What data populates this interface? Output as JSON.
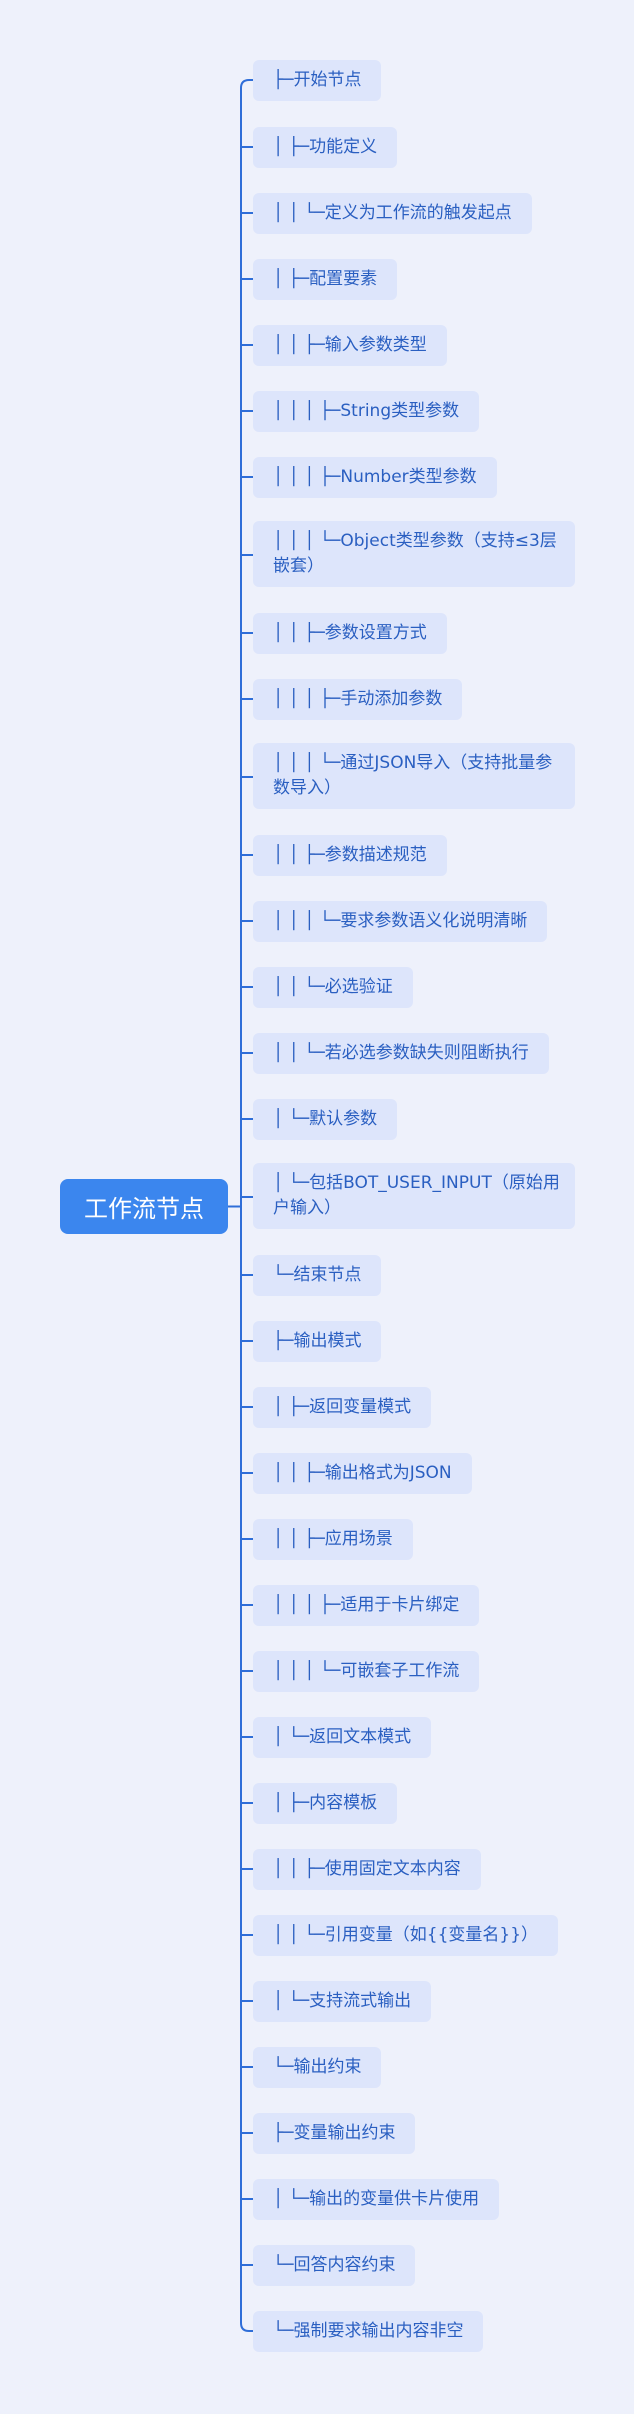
{
  "root": {
    "label": "工作流节点"
  },
  "colors": {
    "background": "#eef1fb",
    "root_fill": "#3b86ee",
    "root_text": "#ffffff",
    "node_fill": "#dde5fb",
    "node_text": "#2a5fc1",
    "connector": "#2f6ed8"
  },
  "nodes": [
    "├─开始节点",
    "│ ├─功能定义",
    "│ │ └─定义为工作流的触发起点",
    "│ ├─配置要素",
    "│ │ ├─输入参数类型",
    "│ │ │ ├─String类型参数",
    "│ │ │ ├─Number类型参数",
    "│ │ │ └─Object类型参数（支持≤3层嵌套）",
    "│ │ ├─参数设置方式",
    "│ │ │ ├─手动添加参数",
    "│ │ │ └─通过JSON导入（支持批量参数导入）",
    "│ │ ├─参数描述规范",
    "│ │ │ └─要求参数语义化说明清晰",
    "│ │ └─必选验证",
    "│ │ └─若必选参数缺失则阻断执行",
    "│ └─默认参数",
    "│ └─包括BOT_USER_INPUT（原始用户输入）",
    "└─结束节点",
    "├─输出模式",
    "│ ├─返回变量模式",
    "│ │ ├─输出格式为JSON",
    "│ │ ├─应用场景",
    "│ │ │ ├─适用于卡片绑定",
    "│ │ │ └─可嵌套子工作流",
    "│ └─返回文本模式",
    "│ ├─内容模板",
    "│ │ ├─使用固定文本内容",
    "│ │ └─引用变量（如{{变量名}}）",
    "│ └─支持流式输出",
    "└─输出约束",
    "├─变量输出约束",
    "│ └─输出的变量供卡片使用",
    "└─回答内容约束",
    "└─强制要求输出内容非空"
  ]
}
